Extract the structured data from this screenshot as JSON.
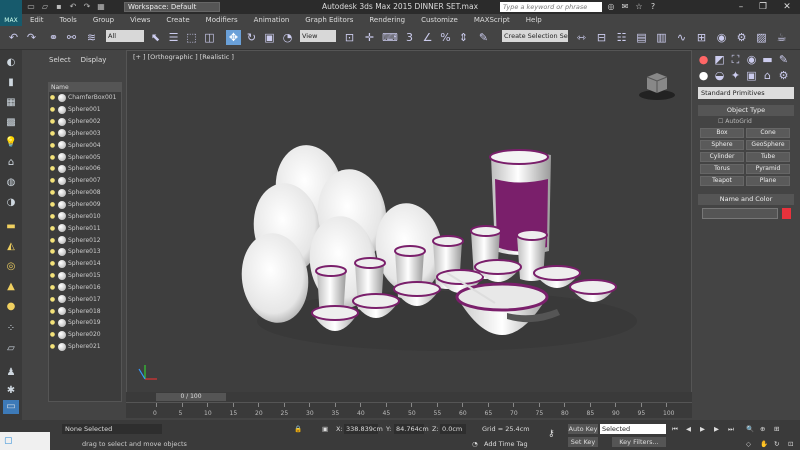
{
  "app": {
    "logo": "MAX",
    "workspace": "Workspace: Default",
    "title": "Autodesk 3ds Max  2015    DINNER SET.max",
    "search_placeholder": "Type a keyword or phrase"
  },
  "menubar": [
    "Edit",
    "Tools",
    "Group",
    "Views",
    "Create",
    "Modifiers",
    "Animation",
    "Graph Editors",
    "Rendering",
    "Customize",
    "MAXScript",
    "Help"
  ],
  "toolbar": {
    "selection_filter": "All",
    "reference_coord": "View",
    "named_selection": "Create Selection Se"
  },
  "scene_explorer": {
    "tabs": [
      "Select",
      "Display"
    ],
    "column_header": "Name",
    "objects": [
      "ChamferBox001",
      "Sphere001",
      "Sphere002",
      "Sphere003",
      "Sphere004",
      "Sphere005",
      "Sphere006",
      "Sphere007",
      "Sphere008",
      "Sphere009",
      "Sphere010",
      "Sphere011",
      "Sphere012",
      "Sphere013",
      "Sphere014",
      "Sphere015",
      "Sphere016",
      "Sphere017",
      "Sphere018",
      "Sphere019",
      "Sphere020",
      "Sphere021"
    ]
  },
  "viewport": {
    "label": "[+ ] [Orthographic ] [Realistic ]"
  },
  "command_panel": {
    "category": "Standard Primitives",
    "object_type_header": "Object Type",
    "autogrid": "AutoGrid",
    "buttons": [
      "Box",
      "Cone",
      "Sphere",
      "GeoSphere",
      "Cylinder",
      "Tube",
      "Torus",
      "Pyramid",
      "Teapot",
      "Plane"
    ],
    "name_color_header": "Name and Color"
  },
  "timeline": {
    "frame": "0 / 100",
    "ticks": [
      "0",
      "5",
      "10",
      "15",
      "20",
      "25",
      "30",
      "35",
      "40",
      "45",
      "50",
      "55",
      "60",
      "65",
      "70",
      "75",
      "80",
      "85",
      "90",
      "95",
      "100"
    ]
  },
  "status": {
    "selection": "None Selected",
    "prompt": "drag to select and move objects",
    "x_label": "X:",
    "x_value": "338.839cm",
    "y_label": "Y:",
    "y_value": "84.764cm",
    "z_label": "Z:",
    "z_value": "0.0cm",
    "grid": "Grid = 25.4cm",
    "add_time_tag": "Add Time Tag",
    "auto_key": "Auto Key",
    "set_key": "Set Key",
    "key_mode": "Selected",
    "key_filters": "Key Filters..."
  },
  "colors": {
    "accent_purple": "#7a1f6b",
    "selected_red": "#e8323c"
  }
}
